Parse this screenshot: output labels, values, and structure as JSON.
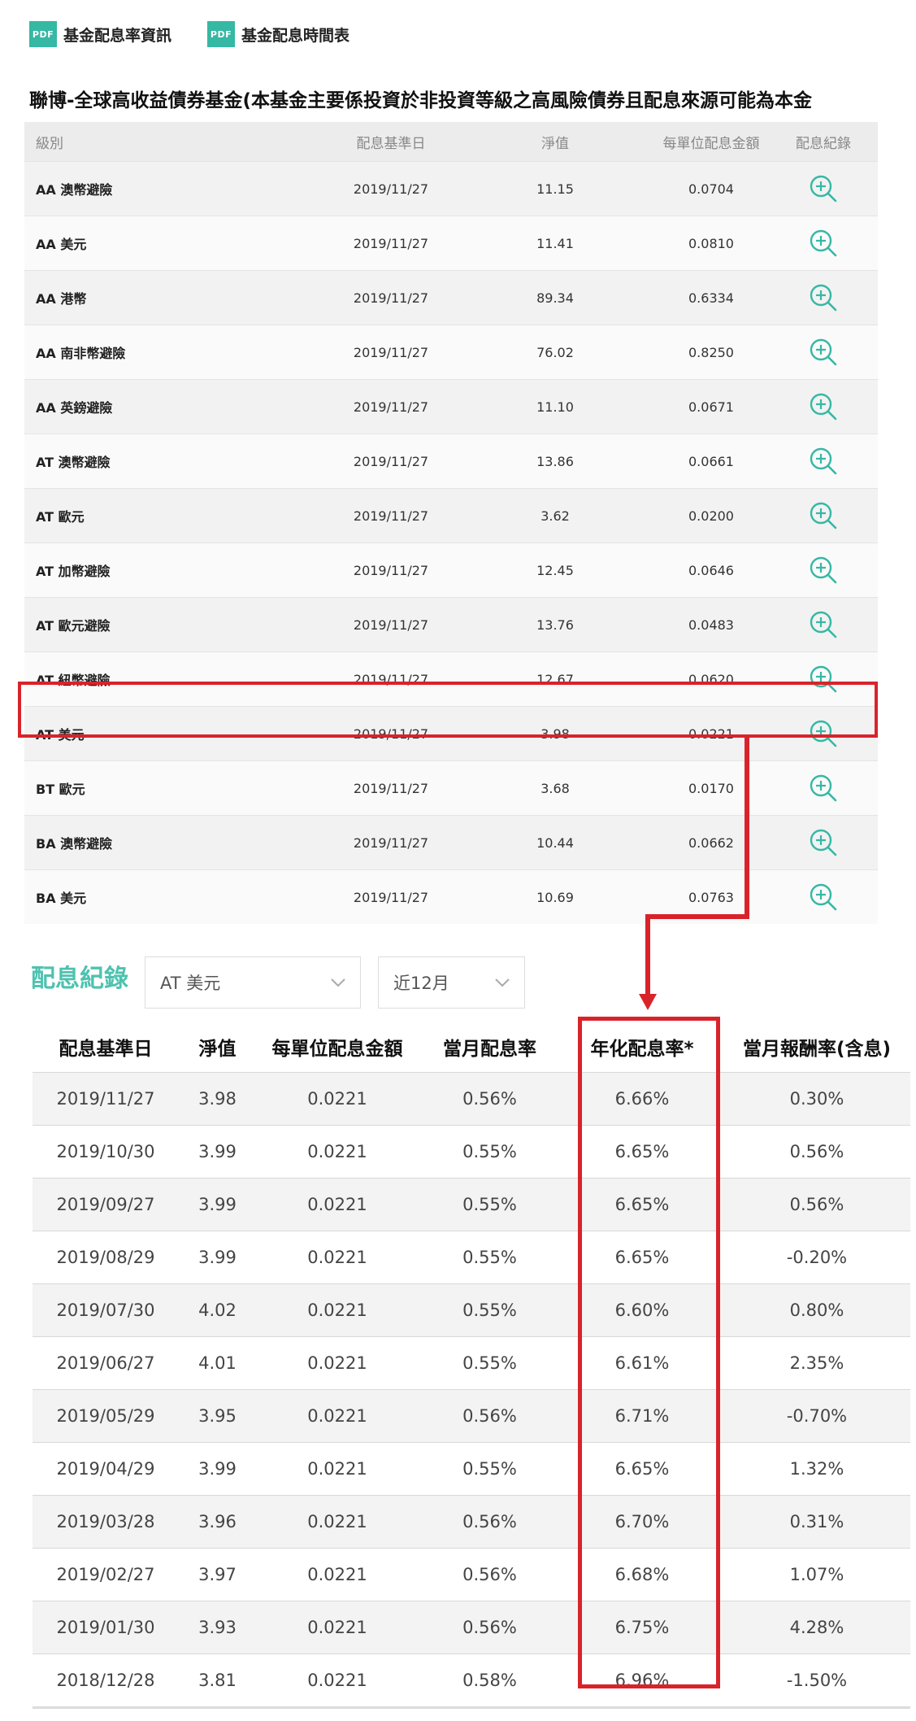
{
  "links": [
    {
      "badge": "PDF",
      "label": "基金配息率資訊"
    },
    {
      "badge": "PDF",
      "label": "基金配息時間表"
    }
  ],
  "fund_title": "聯博-全球高收益債券基金(本基金主要係投資於非投資等級之高風險債券且配息來源可能為本金",
  "top_table": {
    "headers": [
      "級別",
      "配息基準日",
      "淨值",
      "每單位配息金額",
      "配息紀錄"
    ],
    "rows": [
      {
        "class": "AA 澳幣避險",
        "date": "2019/11/27",
        "nav": "11.15",
        "amount": "0.0704"
      },
      {
        "class": "AA 美元",
        "date": "2019/11/27",
        "nav": "11.41",
        "amount": "0.0810"
      },
      {
        "class": "AA 港幣",
        "date": "2019/11/27",
        "nav": "89.34",
        "amount": "0.6334"
      },
      {
        "class": "AA 南非幣避險",
        "date": "2019/11/27",
        "nav": "76.02",
        "amount": "0.8250"
      },
      {
        "class": "AA 英鎊避險",
        "date": "2019/11/27",
        "nav": "11.10",
        "amount": "0.0671"
      },
      {
        "class": "AT 澳幣避險",
        "date": "2019/11/27",
        "nav": "13.86",
        "amount": "0.0661"
      },
      {
        "class": "AT 歐元",
        "date": "2019/11/27",
        "nav": "3.62",
        "amount": "0.0200"
      },
      {
        "class": "AT 加幣避險",
        "date": "2019/11/27",
        "nav": "12.45",
        "amount": "0.0646"
      },
      {
        "class": "AT 歐元避險",
        "date": "2019/11/27",
        "nav": "13.76",
        "amount": "0.0483"
      },
      {
        "class": "AT 紐幣避險",
        "date": "2019/11/27",
        "nav": "12.67",
        "amount": "0.0620"
      },
      {
        "class": "AT 美元",
        "date": "2019/11/27",
        "nav": "3.98",
        "amount": "0.0221"
      },
      {
        "class": "BT 歐元",
        "date": "2019/11/27",
        "nav": "3.68",
        "amount": "0.0170"
      },
      {
        "class": "BA 澳幣避險",
        "date": "2019/11/27",
        "nav": "10.44",
        "amount": "0.0662"
      },
      {
        "class": "BA 美元",
        "date": "2019/11/27",
        "nav": "10.69",
        "amount": "0.0763"
      }
    ]
  },
  "record": {
    "title": "配息紀錄",
    "class_select": "AT 美元",
    "period_select": "近12月",
    "headers": [
      "配息基準日",
      "淨值",
      "每單位配息金額",
      "當月配息率",
      "年化配息率*",
      "當月報酬率(含息)"
    ],
    "rows": [
      [
        "2019/11/27",
        "3.98",
        "0.0221",
        "0.56%",
        "6.66%",
        "0.30%"
      ],
      [
        "2019/10/30",
        "3.99",
        "0.0221",
        "0.55%",
        "6.65%",
        "0.56%"
      ],
      [
        "2019/09/27",
        "3.99",
        "0.0221",
        "0.55%",
        "6.65%",
        "0.56%"
      ],
      [
        "2019/08/29",
        "3.99",
        "0.0221",
        "0.55%",
        "6.65%",
        "-0.20%"
      ],
      [
        "2019/07/30",
        "4.02",
        "0.0221",
        "0.55%",
        "6.60%",
        "0.80%"
      ],
      [
        "2019/06/27",
        "4.01",
        "0.0221",
        "0.55%",
        "6.61%",
        "2.35%"
      ],
      [
        "2019/05/29",
        "3.95",
        "0.0221",
        "0.56%",
        "6.71%",
        "-0.70%"
      ],
      [
        "2019/04/29",
        "3.99",
        "0.0221",
        "0.55%",
        "6.65%",
        "1.32%"
      ],
      [
        "2019/03/28",
        "3.96",
        "0.0221",
        "0.56%",
        "6.70%",
        "0.31%"
      ],
      [
        "2019/02/27",
        "3.97",
        "0.0221",
        "0.56%",
        "6.68%",
        "1.07%"
      ],
      [
        "2019/01/30",
        "3.93",
        "0.0221",
        "0.56%",
        "6.75%",
        "4.28%"
      ],
      [
        "2018/12/28",
        "3.81",
        "0.0221",
        "0.58%",
        "6.96%",
        "-1.50%"
      ]
    ]
  },
  "colors": {
    "accent": "#35b8a4",
    "highlight": "#d9232a"
  },
  "icons": {
    "record": "zoom-in-icon",
    "select": "chevron-down-icon"
  }
}
